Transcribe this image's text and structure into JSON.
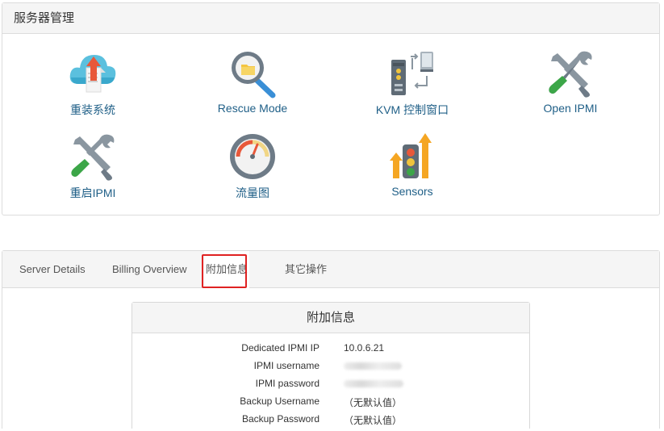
{
  "panel": {
    "title": "服务器管理",
    "tiles": [
      {
        "label": "重装系统",
        "icon": "cloud-upload-icon"
      },
      {
        "label": "Rescue Mode",
        "icon": "magnifier-icon"
      },
      {
        "label": "KVM 控制窗口",
        "icon": "kvm-switch-icon"
      },
      {
        "label": "Open IPMI",
        "icon": "tools-icon"
      },
      {
        "label": "重启IPMI",
        "icon": "tools-icon"
      },
      {
        "label": "流量图",
        "icon": "gauge-icon"
      },
      {
        "label": "Sensors",
        "icon": "traffic-light-icon"
      }
    ]
  },
  "tabs": [
    {
      "label": "Server Details"
    },
    {
      "label": "Billing Overview"
    },
    {
      "label": "附加信息",
      "active": true
    },
    {
      "label": "其它操作"
    }
  ],
  "info": {
    "title": "附加信息",
    "rows": [
      {
        "key": "Dedicated IPMI IP",
        "value": "10.0.6.21"
      },
      {
        "key": "IPMI username",
        "value": ""
      },
      {
        "key": "IPMI password",
        "value": ""
      },
      {
        "key": "Backup Username",
        "value": "（无默认值）"
      },
      {
        "key": "Backup Password",
        "value": "（无默认值）"
      }
    ]
  },
  "colors": {
    "link": "#1f5f87",
    "highlight": "#e02222",
    "header_bg": "#f5f5f5"
  }
}
